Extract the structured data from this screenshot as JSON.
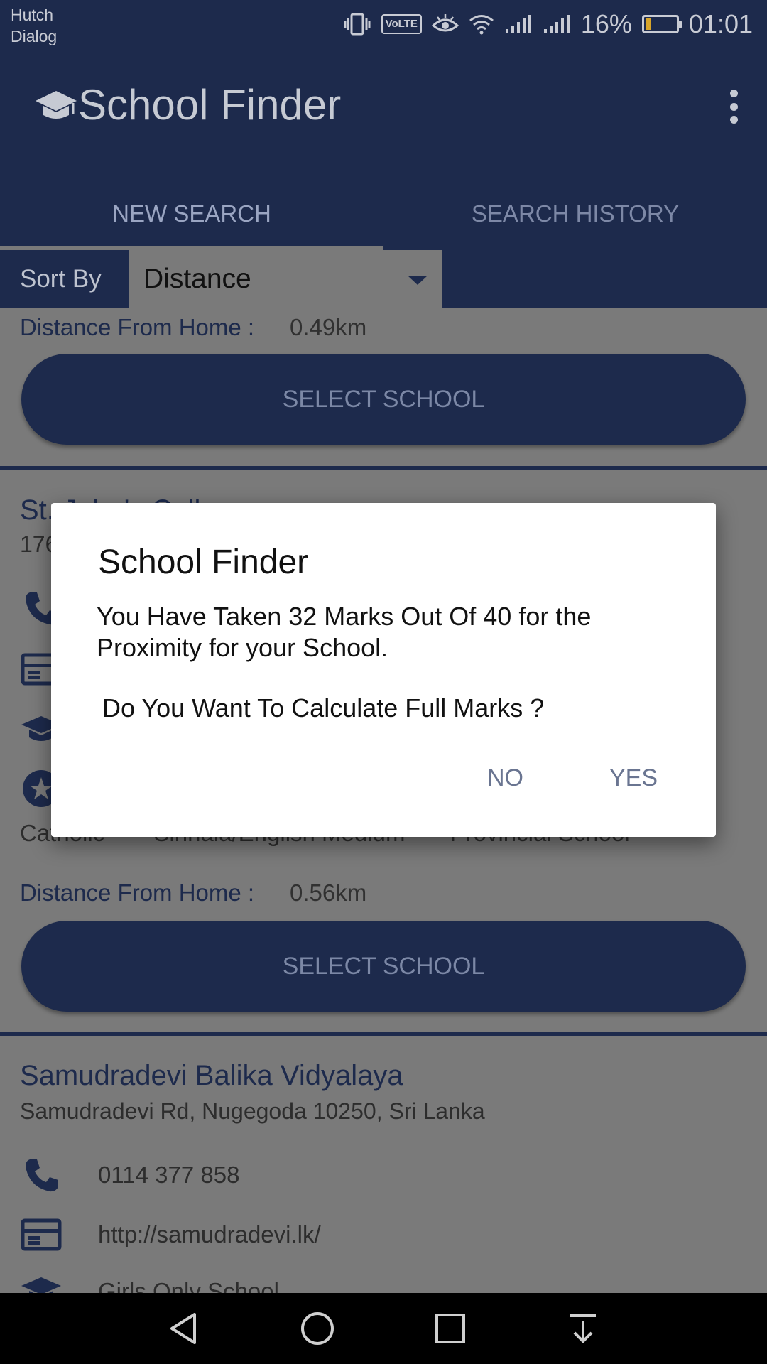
{
  "status_bar": {
    "carrier_line1": "Hutch",
    "carrier_line2": "Dialog",
    "volte": "VoLTE",
    "battery_percent": "16%",
    "battery_level": 0.16,
    "time": "01:01",
    "icons": [
      "vibrate-icon",
      "volte-icon",
      "eye-icon",
      "wifi-icon",
      "signal-icon",
      "signal-icon",
      "battery-icon"
    ]
  },
  "app_bar": {
    "title": "School Finder",
    "logo_icon": "graduation-cap-icon",
    "menu_icon": "more-vert-icon"
  },
  "tabs": [
    {
      "label": "NEW SEARCH",
      "active": true
    },
    {
      "label": "SEARCH HISTORY",
      "active": false
    }
  ],
  "sort": {
    "label": "Sort By",
    "value": "Distance"
  },
  "list": {
    "card1": {
      "distance_label": "Distance From Home :",
      "distance_value": "0.49km",
      "button_label": "SELECT SCHOOL"
    },
    "card2": {
      "name": "St. John's College",
      "address": "176",
      "tag_religion": "Catholic",
      "tag_medium": "Sinhala/English Medium",
      "tag_type": "Provincial School",
      "distance_label": "Distance From Home :",
      "distance_value": "0.56km",
      "button_label": "SELECT SCHOOL"
    },
    "card3": {
      "name": "Samudradevi Balika Vidyalaya",
      "address": "Samudradevi Rd, Nugegoda 10250, Sri Lanka",
      "phone": "0114 377 858",
      "website": "http://samudradevi.lk/",
      "category": "Girls Only School"
    }
  },
  "dialog": {
    "title": "School Finder",
    "message": "You Have Taken 32 Marks Out Of 40  for the Proximity for your School.",
    "question": "Do You Want To Calculate Full Marks ?",
    "no_label": "NO",
    "yes_label": "YES"
  },
  "nav_bar": {
    "icons": [
      "back-icon",
      "home-icon",
      "recents-icon",
      "notification-pull-icon"
    ]
  },
  "colors": {
    "primary": "#1d2a4c",
    "scrim_background": "#7a7a7a",
    "dialog_button": "#6a7591"
  }
}
